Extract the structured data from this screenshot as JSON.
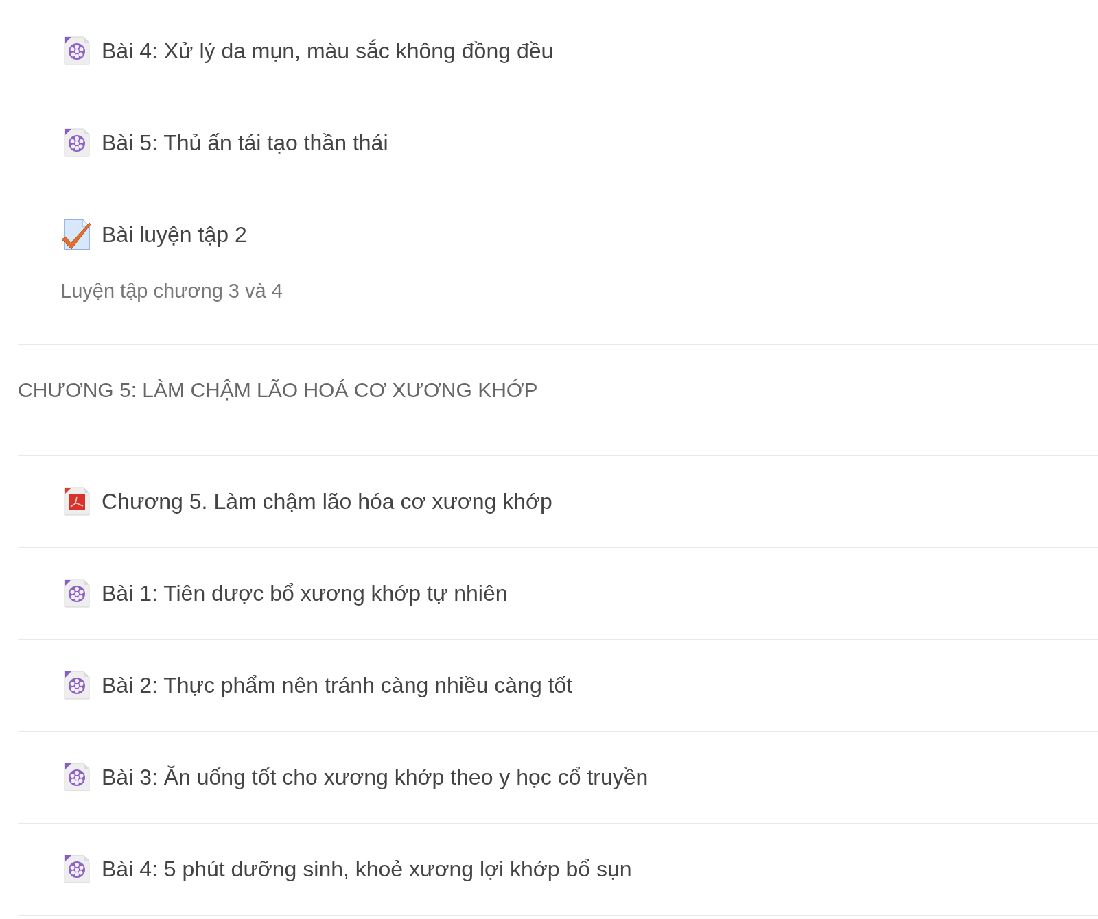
{
  "entries": [
    {
      "kind": "video",
      "title": "Bài 4: Xử lý da mụn, màu sắc không đồng đều"
    },
    {
      "kind": "video",
      "title": "Bài 5: Thủ ấn tái tạo thần thái"
    },
    {
      "kind": "quiz",
      "title": "Bài luyện tập 2",
      "description": "Luyện tập chương 3 và 4"
    },
    {
      "kind": "section",
      "title": "CHƯƠNG 5: LÀM CHẬM LÃO HOÁ CƠ XƯƠNG KHỚP"
    },
    {
      "kind": "pdf",
      "title": "Chương 5. Làm chậm lão hóa cơ xương khớp"
    },
    {
      "kind": "video",
      "title": "Bài 1: Tiên dược bổ xương khớp tự nhiên"
    },
    {
      "kind": "video",
      "title": "Bài 2: Thực phẩm nên tránh càng nhiều càng tốt"
    },
    {
      "kind": "video",
      "title": "Bài 3: Ăn uống tốt cho xương khớp theo y học cổ truyền"
    },
    {
      "kind": "video",
      "title": "Bài 4: 5 phút dưỡng sinh, khoẻ xương lợi khớp bổ sụn"
    }
  ]
}
